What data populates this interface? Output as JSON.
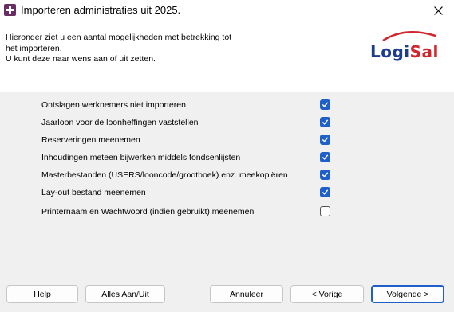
{
  "window": {
    "title": "Importeren administraties uit 2025.",
    "icon": "app-plus-icon",
    "close_icon": "close-icon"
  },
  "header": {
    "lines": [
      "Hieronder ziet u een aantal mogelijkheden met betrekking tot",
      "het importeren.",
      "U kunt deze naar wens aan of uit zetten."
    ],
    "logo": {
      "part1": "Logi",
      "part2": "Sal",
      "color_blue": "#1e3c8e",
      "color_red": "#d0262d"
    }
  },
  "options": [
    {
      "label": "Ontslagen werknemers niet importeren",
      "checked": true
    },
    {
      "label": "Jaarloon voor de loonheffingen vaststellen",
      "checked": true
    },
    {
      "label": "Reserveringen meenemen",
      "checked": true
    },
    {
      "label": "Inhoudingen meteen bijwerken middels fondsenlijsten",
      "checked": true
    },
    {
      "label": "Masterbestanden (USERS/looncode/grootboek) enz. meekopiëren",
      "checked": true
    },
    {
      "label": "Lay-out bestand meenemen",
      "checked": true
    },
    {
      "label": "Printernaam en Wachtwoord (indien gebruikt) meenemen",
      "checked": false
    }
  ],
  "buttons": {
    "help": "Help",
    "toggle_all": "Alles Aan/Uit",
    "cancel": "Annuleer",
    "previous": "< Vorige",
    "next": "Volgende >"
  },
  "colors": {
    "accent": "#1f5fc8",
    "background": "#f0f0f0"
  }
}
